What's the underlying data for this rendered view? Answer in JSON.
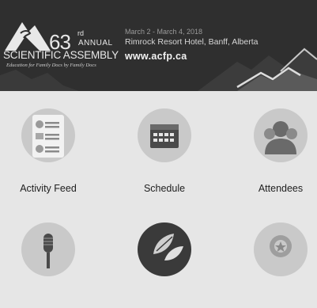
{
  "banner": {
    "logo_number": "63",
    "logo_superscript": "rd",
    "logo_annual": "ANNUAL",
    "logo_assembly": "SCIENTIFIC ASSEMBLY",
    "logo_tagline": "Education for Family Docs by Family Docs",
    "dates": "March 2 - March 4, 2018",
    "venue": "Rimrock Resort Hotel, Banff, Alberta",
    "url": "www.acfp.ca"
  },
  "tiles": [
    {
      "label": "Activity Feed",
      "icon": "activity-feed-icon"
    },
    {
      "label": "Schedule",
      "icon": "calendar-icon"
    },
    {
      "label": "Attendees",
      "icon": "people-icon"
    },
    {
      "label": "",
      "icon": "microphone-icon"
    },
    {
      "label": "",
      "icon": "leaves-icon"
    },
    {
      "label": "",
      "icon": "badge-icon"
    }
  ]
}
